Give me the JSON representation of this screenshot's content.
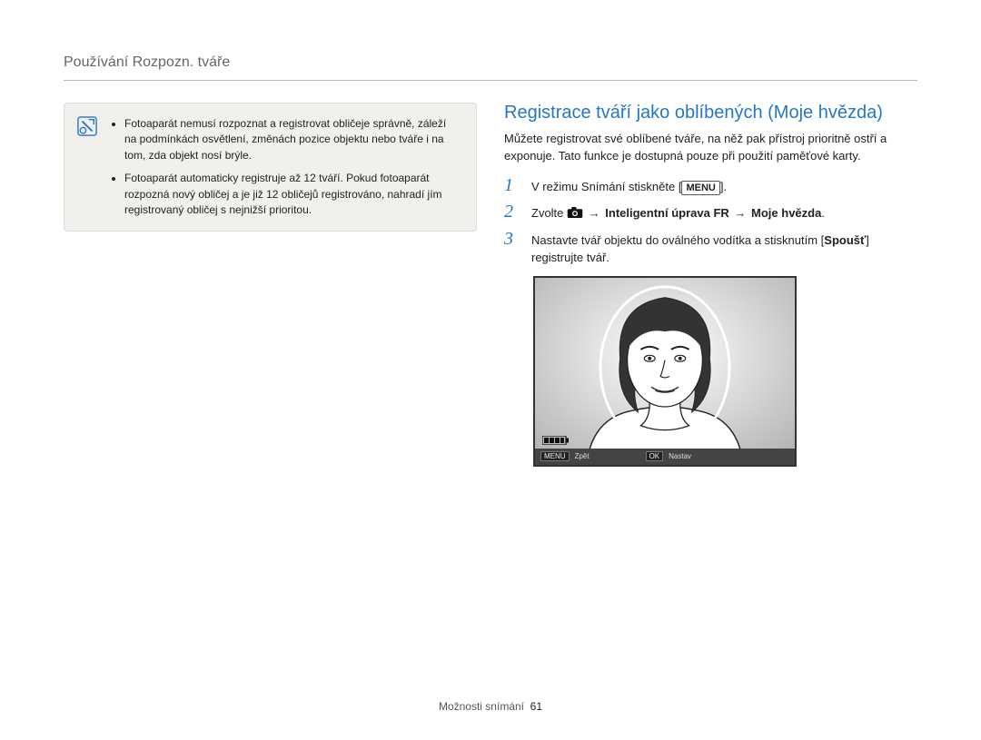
{
  "breadcrumb": "Používání Rozpozn. tváře",
  "note": {
    "bullets": [
      "Fotoaparát nemusí rozpoznat a registrovat obličeje správně, záleží na podmínkách osvětlení, změnách pozice objektu nebo tváře i na tom, zda objekt nosí brýle.",
      "Fotoaparát automaticky registruje až 12 tváří. Pokud fotoaparát rozpozná nový obličej a je již 12 obličejů registrováno, nahradí jím registrovaný obličej s nejnižší prioritou."
    ]
  },
  "section": {
    "title": "Registrace tváří jako oblíbených (Moje hvězda)",
    "intro": "Můžete registrovat své oblíbené tváře, na něž pak přístroj prioritně ostří a exponuje. Tato funkce je dostupná pouze při použití paměťové karty."
  },
  "steps": {
    "s1": {
      "pre": "V režimu Snímání stiskněte [",
      "menu": "MENU",
      "post": "]."
    },
    "s2": {
      "pre": "Zvolte ",
      "mid1": " → ",
      "bold1": "Inteligentní úprava FR",
      "mid2": " → ",
      "bold2": "Moje hvězda",
      "post": "."
    },
    "s3": {
      "line1a": "Nastavte tvář objektu do oválného vodítka a stisknutím ",
      "line1b": "[",
      "bold": "Spoušť",
      "line1c": "] registrujte tvář."
    }
  },
  "lcd": {
    "menu_btn": "MENU",
    "menu_label": "Zpět",
    "ok_btn": "OK",
    "ok_label": "Nastav"
  },
  "footer": {
    "label": "Možnosti snímání",
    "page": "61"
  }
}
